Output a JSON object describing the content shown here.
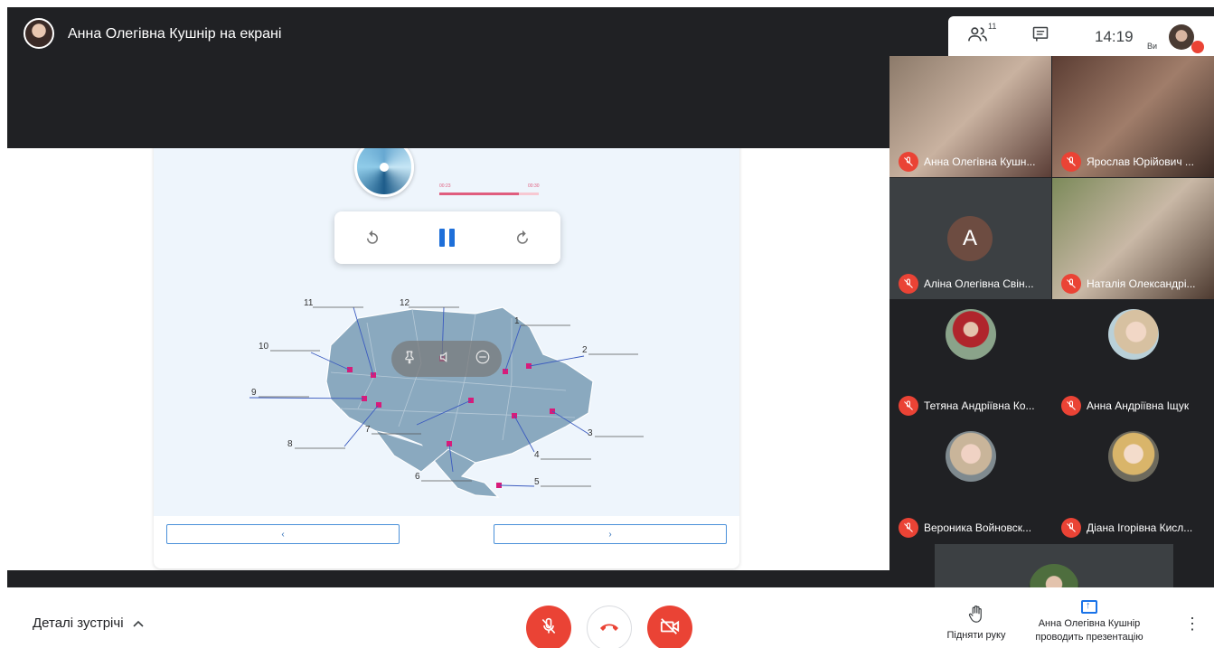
{
  "presenter": {
    "title": "Анна Олегівна Кушнір на екрані"
  },
  "top_bar": {
    "participants_count": "11",
    "time": "14:19",
    "you_label": "Ви"
  },
  "player": {
    "current": "00:23",
    "duration": "00:30",
    "progress": 0.8
  },
  "map": {
    "labels": [
      "1",
      "2",
      "3",
      "4",
      "5",
      "6",
      "7",
      "8",
      "9",
      "10",
      "11",
      "12"
    ]
  },
  "participants": [
    {
      "name": "Анна Олегівна Кушн..."
    },
    {
      "name": "Ярослав Юрійович ..."
    },
    {
      "name": "Аліна Олегівна Свін...",
      "initial": "A"
    },
    {
      "name": "Наталія Олександрі..."
    },
    {
      "name": "Тетяна Андріївна Ко..."
    },
    {
      "name": "Анна Андріївна Іщук"
    },
    {
      "name": "Вероника Войновск..."
    },
    {
      "name": "Діана Ігорівна Кисл..."
    }
  ],
  "footer": {
    "details_label": "Деталі зустрічі",
    "raise_hand": "Підняти руку",
    "presenting_name": "Анна Олегівна Кушнір",
    "presenting_text": "проводить презентацію"
  },
  "colors": {
    "accent": "#1a73e8",
    "danger": "#ea4335",
    "dark": "#202124",
    "map": "#8aa9bf"
  },
  "icons": {
    "people": "people-icon",
    "chat": "chat-icon",
    "undo": "rewind-icon",
    "pause": "pause-icon",
    "redo": "forward-icon",
    "pin": "pin-icon",
    "volume": "mute-icon",
    "remove": "remove-icon",
    "mic": "mic-off-icon",
    "hangup": "hangup-icon",
    "camera": "camera-off-icon",
    "hand": "hand-icon",
    "present": "present-icon",
    "more": "more-vert-icon"
  }
}
